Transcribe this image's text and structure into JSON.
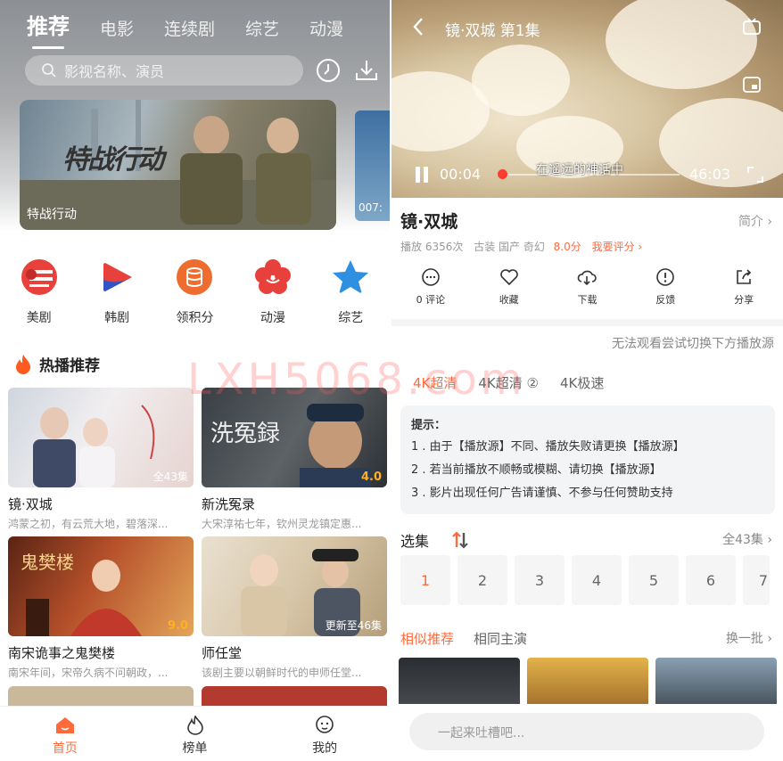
{
  "left": {
    "tabs": [
      "推荐",
      "电影",
      "连续剧",
      "综艺",
      "动漫"
    ],
    "search_placeholder": "影视名称、演员",
    "banner": {
      "title": "特战行动",
      "logo": "特战行动"
    },
    "banner2": {
      "duration": "007:"
    },
    "categories": [
      {
        "label": "美剧",
        "icon": "us-flag-icon",
        "color": "#e8413c"
      },
      {
        "label": "韩剧",
        "icon": "play-logo-icon",
        "color": "#e8413c"
      },
      {
        "label": "领积分",
        "icon": "coins-icon",
        "color": "#ef6c2f"
      },
      {
        "label": "动漫",
        "icon": "flower-icon",
        "color": "#e8413c"
      },
      {
        "label": "综艺",
        "icon": "star-icon",
        "color": "#2f8fe0"
      }
    ],
    "section_title": "热播推荐",
    "cards": [
      {
        "name": "镜·双城",
        "desc": "鸿蒙之初，有云荒大地，碧落深...",
        "badge": "全43集",
        "score": ""
      },
      {
        "name": "新洗冤录",
        "desc": "大宋淳祐七年，钦州灵龙镇定惠...",
        "badge": "",
        "score": "4.0"
      },
      {
        "name": "南宋诡事之鬼樊楼",
        "desc": "南宋年间，宋帝久病不问朝政，...",
        "badge": "",
        "score": "9.0"
      },
      {
        "name": "师任堂",
        "desc": "该剧主要以朝鲜时代的申师任堂...",
        "badge": "更新至46集",
        "score": ""
      }
    ],
    "bottom_nav": [
      "首页",
      "榜单",
      "我的"
    ]
  },
  "right": {
    "player": {
      "title": "镜·双城 第1集",
      "current_time": "00:04",
      "total_time": "46:03",
      "subtitle": "在遥远的神话中"
    },
    "video_title": "镜·双城",
    "intro_label": "简介",
    "meta": {
      "plays": "播放 6356次",
      "tags": "古装 国产 奇幻",
      "score": "8.0分",
      "rate": "我要评分"
    },
    "actions": [
      "0 评论",
      "收藏",
      "下载",
      "反馈",
      "分享"
    ],
    "note": "无法观看尝试切换下方播放源",
    "sources": [
      "4K超清",
      "4K超清 ②",
      "4K极速"
    ],
    "tips": {
      "heading": "提示：",
      "lines": [
        "1 . 由于【播放源】不同、播放失败请更换【播放源】",
        "2 . 若当前播放不顺畅或模糊、请切换【播放源】",
        "3 . 影片出现任何广告请谨慎、不参与任何赞助支持"
      ]
    },
    "episodes_label": "选集",
    "episodes_total": "全43集",
    "episodes": [
      "1",
      "2",
      "3",
      "4",
      "5",
      "6",
      "7"
    ],
    "similar_tabs": [
      "相似推荐",
      "相同主演"
    ],
    "swap_label": "换一批",
    "comment_placeholder": "一起来吐槽吧..."
  },
  "watermark": "LXH5068.com",
  "colors": {
    "accent": "#ff6a3c"
  }
}
